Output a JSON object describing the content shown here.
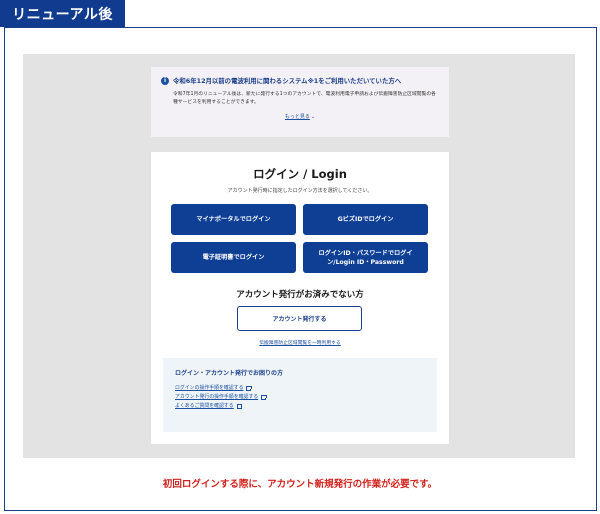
{
  "header": {
    "tag": "リニューアル後"
  },
  "notice": {
    "title": "令和6年12月以前の電波利用に関わるシステム※1をご利用いただいていた方へ",
    "body": "令和7年1月のリニューアル後は、新たに発行する1つのアカウントで、電波利用電子申請および伝搬障害防止区域閲覧の各種サービスを利用することができます。",
    "more_link": "もっと見る",
    "icon": "info-icon"
  },
  "login": {
    "title": "ログイン / Login",
    "subtitle": "アカウント発行時に指定したログイン方法を選択してください。",
    "buttons": {
      "mynaportal": "マイナポータルでログイン",
      "gbiz": "GビズIDでログイン",
      "certificate": "電子証明書でログイン",
      "idpw_line1": "ログインID・パスワードでログイン/Login ID・Password"
    },
    "account_title": "アカウント発行がお済みでない方",
    "account_button": "アカウント発行する",
    "account_link": "伝搬障害防止区域閲覧を一時利用する"
  },
  "help": {
    "title": "ログイン・アカウント発行でお困りの方",
    "links": [
      "ログインの操作手順を確認する",
      "アカウント発行の操作手順を確認する",
      "よくあるご質問を確認する"
    ]
  },
  "caption": "初回ログインする際に、アカウント新規発行の作業が必要です。",
  "colors": {
    "brand": "#0e3f95",
    "caption": "#d0211c"
  }
}
